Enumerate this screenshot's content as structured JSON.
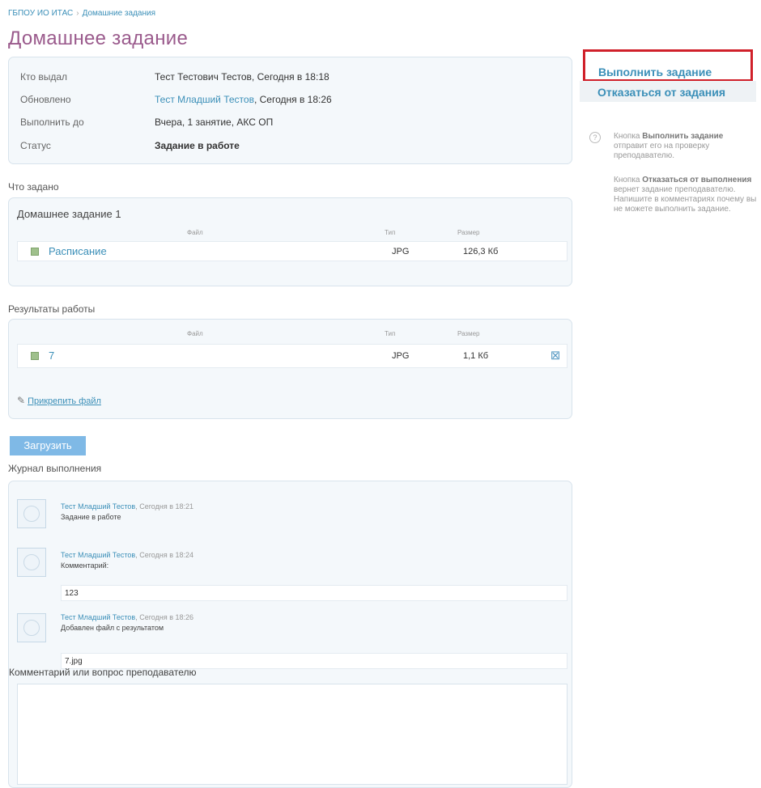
{
  "breadcrumb": {
    "org": "ГБПОУ ИО ИТАС",
    "separator": "›",
    "current": "Домашние задания"
  },
  "page_title": "Домашнее задание",
  "info": {
    "issued_by_label": "Кто выдал",
    "issued_by_value": "Тест Тестович Тестов, Сегодня в 18:18",
    "updated_label": "Обновлено",
    "updated_author": "Тест Младший Тестов",
    "updated_time": ", Сегодня в 18:26",
    "due_label": "Выполнить до",
    "due_value": "Вчера, 1 занятие, АКС ОП",
    "status_label": "Статус",
    "status_value": "Задание в работе"
  },
  "task": {
    "section_label": "Что задано",
    "title": "Домашнее задание 1",
    "col_file": "Файл",
    "col_type": "Тип",
    "col_size": "Размер",
    "files": [
      {
        "name": "Расписание",
        "type": "JPG",
        "size": "126,3 Кб"
      }
    ]
  },
  "results": {
    "section_label": "Результаты работы",
    "col_file": "Файл",
    "col_type": "Тип",
    "col_size": "Размер",
    "files": [
      {
        "name": "7",
        "type": "JPG",
        "size": "1,1 Кб"
      }
    ],
    "attach_label": "Прикрепить файл"
  },
  "upload_label": "Загрузить",
  "log": {
    "section_label": "Журнал выполнения",
    "entries": [
      {
        "author": "Тест Младший Тестов",
        "time": ", Сегодня в 18:21",
        "text": "Задание в работе"
      },
      {
        "author": "Тест Младший Тестов",
        "time": ", Сегодня в 18:24",
        "text": "Комментарий:",
        "comment": "123"
      },
      {
        "author": "Тест Младший Тестов",
        "time": ", Сегодня в 18:26",
        "text": "Добавлен файл с результатом",
        "comment": "7.jpg"
      }
    ],
    "question_label": "Комментарий или вопрос преподавателю"
  },
  "actions": {
    "complete": "Выполнить задание",
    "refuse": "Отказаться от задания"
  },
  "help": {
    "q_icon": "?",
    "p1_pre": "Кнопка ",
    "p1_bold": "Выполнить задание",
    "p1_post": " отправит его на проверку преподавателю.",
    "p2_pre": "Кнопка ",
    "p2_bold": "Отказаться от выполнения",
    "p2_post": " вернет задание преподавателю. Напишите в комментариях почему вы не можете выполнить задание."
  },
  "colors": {
    "title": "#9a5a8c",
    "link": "#3b8fb8",
    "highlight": "#d0202a",
    "upload": "#7fb9e6"
  }
}
